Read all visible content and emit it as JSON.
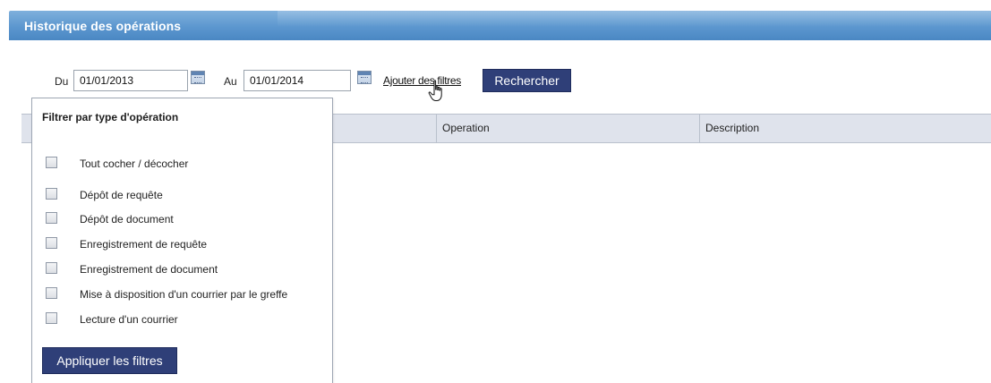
{
  "header": {
    "title": "Historique des opérations"
  },
  "filters": {
    "from_label": "Du",
    "from_value": "01/01/2013",
    "to_label": "Au",
    "to_value": "01/01/2014",
    "add_filters_label": "Ajouter des filtres",
    "search_label": "Rechercher"
  },
  "table": {
    "columns": [
      "",
      "Operation",
      "Description"
    ]
  },
  "popup": {
    "title": "Filtrer par type d'opération",
    "toggle_all": "Tout cocher / décocher",
    "items": [
      "Dépôt de requête",
      "Dépôt de document",
      "Enregistrement de requête",
      "Enregistrement de document",
      "Mise à disposition d'un courrier par le greffe",
      "Lecture d'un courrier"
    ],
    "apply_label": "Appliquer les filtres"
  },
  "colors": {
    "header_blue": "#5c97cf",
    "button_navy": "#2f3f78",
    "table_header_bg": "#dfe3ec"
  },
  "icons": {
    "calendar": "calendar-icon",
    "cursor": "hand-pointer-icon"
  }
}
